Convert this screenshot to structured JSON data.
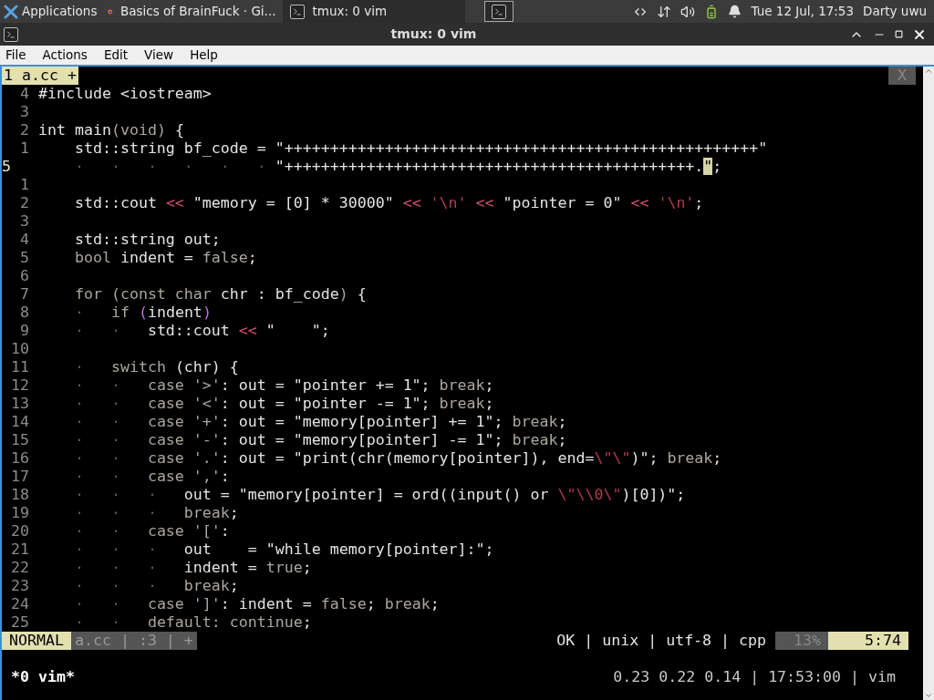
{
  "panel": {
    "apps_label": "Applications",
    "tasks": [
      {
        "title": "Basics of BrainFuck · Gi...",
        "kind": "browser",
        "selected": false
      },
      {
        "title": "tmux: 0 vim",
        "kind": "terminal",
        "selected": true
      }
    ],
    "clock": "Tue 12 Jul, 17:53",
    "user": "Darty uwu"
  },
  "window": {
    "title": "tmux: 0 vim",
    "menu": [
      "File",
      "Actions",
      "Edit",
      "View",
      "Help"
    ]
  },
  "vim": {
    "tabs": [
      {
        "label": "1 a.cc +",
        "selected": true
      }
    ],
    "close_label": "X",
    "lines": [
      {
        "number": "4",
        "current": false,
        "code": [
          {
            "kind": "plain",
            "text": "#include <iostream>"
          }
        ]
      },
      {
        "number": "3",
        "current": false
      },
      {
        "number": "2",
        "current": false,
        "code": [
          {
            "kind": "plain",
            "text": "int main"
          },
          {
            "kind": "keyword",
            "text": "(void)"
          },
          {
            "kind": "plain",
            "text": " {"
          }
        ]
      },
      {
        "number": "1",
        "current": false,
        "code": [
          {
            "kind": "plain",
            "text": "    std::string bf_code = \"++++++++++++++++++++++++++++++++++++++++++++++++++++\""
          }
        ]
      },
      {
        "number": "5",
        "current": true,
        "code": [
          {
            "kind": "listchar",
            "text": "    ·   ·   ·   ·   ·   · "
          },
          {
            "kind": "plain",
            "text": "\"+++++++++++++++++++++++++++++++++++++++++++++."
          },
          {
            "kind": "cursor",
            "text": "\""
          },
          {
            "kind": "plain",
            "text": ";"
          }
        ]
      },
      {
        "number": "1",
        "current": false
      },
      {
        "number": "2",
        "current": false,
        "code": [
          {
            "kind": "plain",
            "text": "    std::cout "
          },
          {
            "kind": "operator",
            "text": "<<"
          },
          {
            "kind": "plain",
            "text": " \"memory = [0] * 30000\" "
          },
          {
            "kind": "operator",
            "text": "<<"
          },
          {
            "kind": "escape",
            "text": " '\\n'"
          },
          {
            "kind": "operator",
            "text": " <<"
          },
          {
            "kind": "plain",
            "text": " \"pointer = 0\" "
          },
          {
            "kind": "operator",
            "text": "<<"
          },
          {
            "kind": "escape",
            "text": " '\\n'"
          },
          {
            "kind": "plain",
            "text": ";"
          }
        ]
      },
      {
        "number": "3",
        "current": false
      },
      {
        "number": "4",
        "current": false,
        "code": [
          {
            "kind": "plain",
            "text": "    std::string out;"
          }
        ]
      },
      {
        "number": "5",
        "current": false,
        "code": [
          {
            "kind": "keyword",
            "text": "    bool"
          },
          {
            "kind": "plain",
            "text": " indent = "
          },
          {
            "kind": "keyword",
            "text": "false"
          },
          {
            "kind": "plain",
            "text": ";"
          }
        ]
      },
      {
        "number": "6",
        "current": false
      },
      {
        "number": "7",
        "current": false,
        "code": [
          {
            "kind": "keyword",
            "text": "    for (const char"
          },
          {
            "kind": "plain",
            "text": " chr : bf_code"
          },
          {
            "kind": "keyword",
            "text": ")"
          },
          {
            "kind": "plain",
            "text": " {"
          }
        ]
      },
      {
        "number": "8",
        "current": false,
        "code": [
          {
            "kind": "listchar",
            "text": "    ·   "
          },
          {
            "kind": "keyword",
            "text": "if "
          },
          {
            "kind": "paren",
            "text": "("
          },
          {
            "kind": "plain",
            "text": "indent"
          },
          {
            "kind": "paren",
            "text": ")"
          }
        ]
      },
      {
        "number": "9",
        "current": false,
        "code": [
          {
            "kind": "listchar",
            "text": "    ·   ·   "
          },
          {
            "kind": "plain",
            "text": "std::cout "
          },
          {
            "kind": "operator",
            "text": "<<"
          },
          {
            "kind": "plain",
            "text": " \"    \";"
          }
        ]
      },
      {
        "number": "10",
        "current": false
      },
      {
        "number": "11",
        "current": false,
        "code": [
          {
            "kind": "listchar",
            "text": "    ·   "
          },
          {
            "kind": "keyword",
            "text": "switch"
          },
          {
            "kind": "plain",
            "text": " (chr) {"
          }
        ]
      },
      {
        "number": "12",
        "current": false,
        "code": [
          {
            "kind": "listchar",
            "text": "    ·   ·   "
          },
          {
            "kind": "keyword",
            "text": "case '>'"
          },
          {
            "kind": "plain",
            "text": ": out = \"pointer += 1\"; "
          },
          {
            "kind": "keyword",
            "text": "break"
          },
          {
            "kind": "plain",
            "text": ";"
          }
        ]
      },
      {
        "number": "13",
        "current": false,
        "code": [
          {
            "kind": "listchar",
            "text": "    ·   ·   "
          },
          {
            "kind": "keyword",
            "text": "case '<'"
          },
          {
            "kind": "plain",
            "text": ": out = \"pointer -= 1\"; "
          },
          {
            "kind": "keyword",
            "text": "break"
          },
          {
            "kind": "plain",
            "text": ";"
          }
        ]
      },
      {
        "number": "14",
        "current": false,
        "code": [
          {
            "kind": "listchar",
            "text": "    ·   ·   "
          },
          {
            "kind": "keyword",
            "text": "case '+'"
          },
          {
            "kind": "plain",
            "text": ": out = \"memory[pointer] += 1\"; "
          },
          {
            "kind": "keyword",
            "text": "break"
          },
          {
            "kind": "plain",
            "text": ";"
          }
        ]
      },
      {
        "number": "15",
        "current": false,
        "code": [
          {
            "kind": "listchar",
            "text": "    ·   ·   "
          },
          {
            "kind": "keyword",
            "text": "case '-'"
          },
          {
            "kind": "plain",
            "text": ": out = \"memory[pointer] -= 1\"; "
          },
          {
            "kind": "keyword",
            "text": "break"
          },
          {
            "kind": "plain",
            "text": ";"
          }
        ]
      },
      {
        "number": "16",
        "current": false,
        "code": [
          {
            "kind": "listchar",
            "text": "    ·   ·   "
          },
          {
            "kind": "keyword",
            "text": "case '.'"
          },
          {
            "kind": "plain",
            "text": ": out = \"print(chr(memory[pointer]), end="
          },
          {
            "kind": "escape",
            "text": "\\\"\\\""
          },
          {
            "kind": "plain",
            "text": ")\"; "
          },
          {
            "kind": "keyword",
            "text": "break"
          },
          {
            "kind": "plain",
            "text": ";"
          }
        ]
      },
      {
        "number": "17",
        "current": false,
        "code": [
          {
            "kind": "listchar",
            "text": "    ·   ·   "
          },
          {
            "kind": "keyword",
            "text": "case ','"
          },
          {
            "kind": "plain",
            "text": ":"
          }
        ]
      },
      {
        "number": "18",
        "current": false,
        "code": [
          {
            "kind": "listchar",
            "text": "    ·   ·   ·   "
          },
          {
            "kind": "plain",
            "text": "out = \"memory[pointer] = ord((input() or "
          },
          {
            "kind": "escape",
            "text": "\\\"\\\\0\\\""
          },
          {
            "kind": "plain",
            "text": ")[0])\";"
          }
        ]
      },
      {
        "number": "19",
        "current": false,
        "code": [
          {
            "kind": "listchar",
            "text": "    ·   ·   ·   "
          },
          {
            "kind": "keyword",
            "text": "break"
          },
          {
            "kind": "plain",
            "text": ";"
          }
        ]
      },
      {
        "number": "20",
        "current": false,
        "code": [
          {
            "kind": "listchar",
            "text": "    ·   ·   "
          },
          {
            "kind": "keyword",
            "text": "case '['"
          },
          {
            "kind": "plain",
            "text": ":"
          }
        ]
      },
      {
        "number": "21",
        "current": false,
        "code": [
          {
            "kind": "listchar",
            "text": "    ·   ·   ·   "
          },
          {
            "kind": "plain",
            "text": "out    = \"while memory[pointer]:\";"
          }
        ]
      },
      {
        "number": "22",
        "current": false,
        "code": [
          {
            "kind": "listchar",
            "text": "    ·   ·   ·   "
          },
          {
            "kind": "plain",
            "text": "indent = "
          },
          {
            "kind": "keyword",
            "text": "true"
          },
          {
            "kind": "plain",
            "text": ";"
          }
        ]
      },
      {
        "number": "23",
        "current": false,
        "code": [
          {
            "kind": "listchar",
            "text": "    ·   ·   ·   "
          },
          {
            "kind": "keyword",
            "text": "break"
          },
          {
            "kind": "plain",
            "text": ";"
          }
        ]
      },
      {
        "number": "24",
        "current": false,
        "code": [
          {
            "kind": "listchar",
            "text": "    ·   ·   "
          },
          {
            "kind": "keyword",
            "text": "case ']'"
          },
          {
            "kind": "plain",
            "text": ": indent = "
          },
          {
            "kind": "keyword",
            "text": "false"
          },
          {
            "kind": "plain",
            "text": "; "
          },
          {
            "kind": "keyword",
            "text": "break"
          },
          {
            "kind": "plain",
            "text": ";"
          }
        ]
      },
      {
        "number": "25",
        "current": false,
        "code": [
          {
            "kind": "listchar",
            "text": "    ·   ·   "
          },
          {
            "kind": "keyword",
            "text": "default: continue"
          },
          {
            "kind": "plain",
            "text": ";"
          }
        ]
      }
    ],
    "statusline": {
      "mode": "NORMAL",
      "file_info": "a.cc | :3 | +",
      "file_meta": "OK | unix | utf-8 | cpp",
      "percent": "13%",
      "position": "5:74"
    }
  },
  "tmux": {
    "session": "*0 vim*",
    "status": "0.23 0.22 0.14 | 17:53:00 | vim"
  }
}
